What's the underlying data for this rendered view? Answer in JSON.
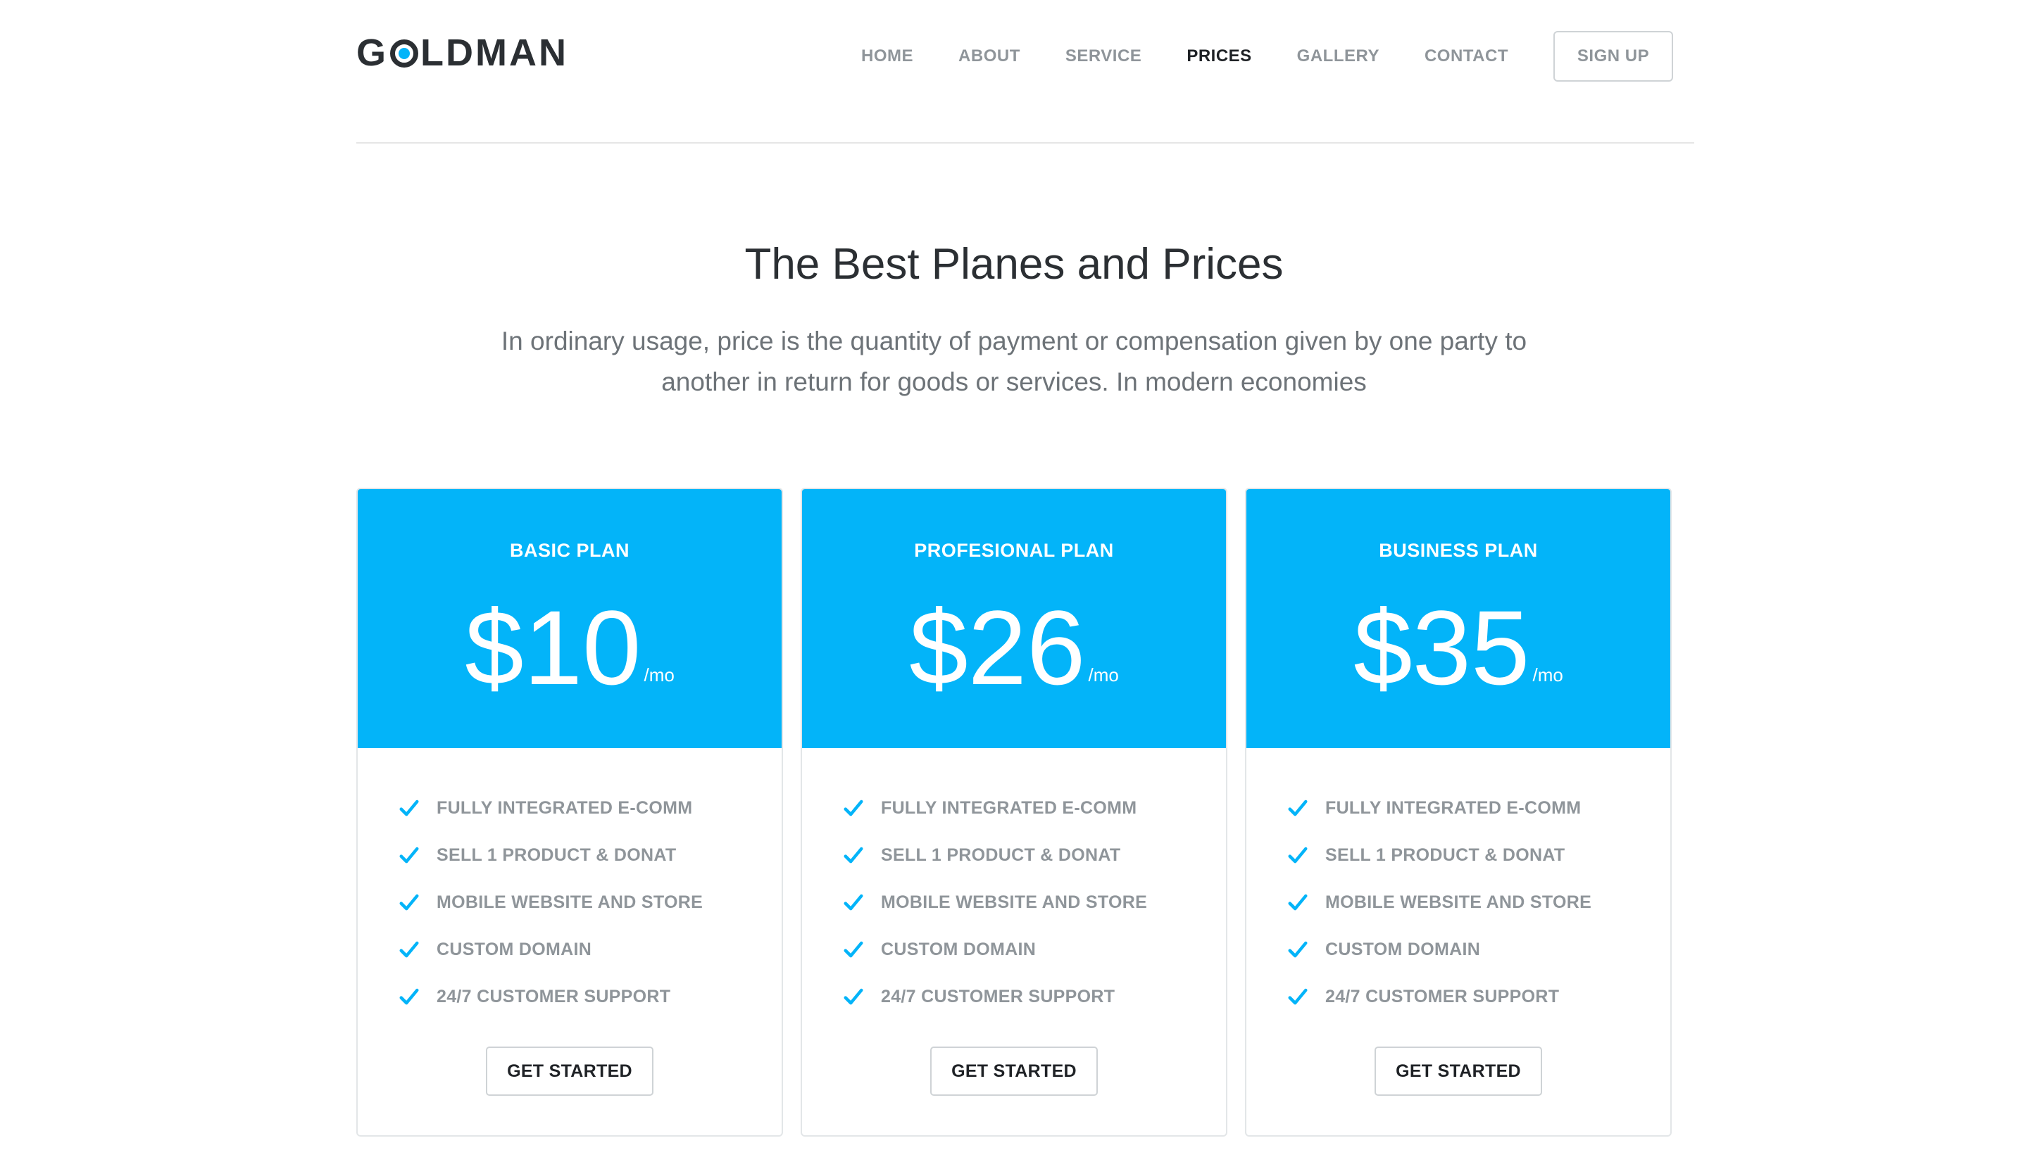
{
  "brand": {
    "logo_prefix": "G",
    "logo_suffix": "LDMAN",
    "accent_color": "#03b4f9"
  },
  "nav": {
    "items": [
      {
        "label": "HOME"
      },
      {
        "label": "ABOUT"
      },
      {
        "label": "SERVICE"
      },
      {
        "label": "PRICES",
        "active": true
      },
      {
        "label": "GALLERY"
      },
      {
        "label": "CONTACT"
      }
    ],
    "signup_label": "SIGN UP"
  },
  "hero": {
    "title": "The Best Planes and Prices",
    "subtitle": "In ordinary usage, price is the quantity of payment or compensation given by one party to another in return for goods or services. In modern economies"
  },
  "plans": [
    {
      "name": "BASIC PLAN",
      "price": "$10",
      "period": "/mo",
      "features": [
        "FULLY INTEGRATED E-COMM",
        "SELL 1 PRODUCT & DONAT",
        "MOBILE WEBSITE AND STORE",
        "CUSTOM DOMAIN",
        "24/7 CUSTOMER SUPPORT"
      ],
      "cta": "GET STARTED"
    },
    {
      "name": "PROFESIONAL PLAN",
      "price": "$26",
      "period": "/mo",
      "features": [
        "FULLY INTEGRATED E-COMM",
        "SELL 1 PRODUCT & DONAT",
        "MOBILE WEBSITE AND STORE",
        "CUSTOM DOMAIN",
        "24/7 CUSTOMER SUPPORT"
      ],
      "cta": "GET STARTED"
    },
    {
      "name": "BUSINESS PLAN",
      "price": "$35",
      "period": "/mo",
      "features": [
        "FULLY INTEGRATED E-COMM",
        "SELL 1 PRODUCT & DONAT",
        "MOBILE WEBSITE AND STORE",
        "CUSTOM DOMAIN",
        "24/7 CUSTOMER SUPPORT"
      ],
      "cta": "GET STARTED"
    }
  ],
  "icons": {
    "feature_icon": "check-icon"
  }
}
